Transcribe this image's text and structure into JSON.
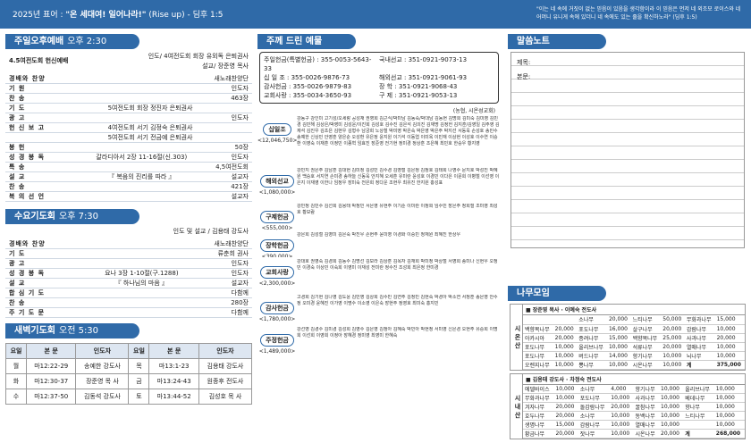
{
  "topbar": {
    "year_theme_prefix": "2025년 표어 : ",
    "theme": "\"온 세대여! 일어나라!\"",
    "theme_rest": " (Rise up) - 딤후 1:5",
    "verse": "\"이는 네 속에 거짓이 없는 믿음이 있음을 생각함이라 이 믿음은 먼저 네 외조모 로이스와 네 어머니 유니게 속에 있더니 네 속에도 있는 줄을 확신하노라\" (딤후 1:5)"
  },
  "sunday": {
    "header": "주일오후예배",
    "time": "오후 2:30",
    "intro_left": "4.5여전도회 헌신예배",
    "intro_right1": "인도/ 4여전도회 회장 유외독 은퇴권사",
    "intro_right2": "설교/ 장준영 목사",
    "rows": [
      {
        "k": "경배와 찬양",
        "m": "",
        "r": "새노래찬양단"
      },
      {
        "k": "기 원",
        "m": "",
        "r": "인도자"
      },
      {
        "k": "찬 송",
        "m": "",
        "r": "463장"
      },
      {
        "k": "기 도",
        "m": "5여전도회 회장 정진자 은퇴권사",
        "r": ""
      },
      {
        "k": "광 고",
        "m": "",
        "r": "인도자"
      },
      {
        "k": "헌 신 보 고",
        "m": "4여전도회 서기 김정숙 은퇴권사",
        "r": ""
      },
      {
        "k": "",
        "m": "5여전도회 서기 전금예 은퇴권사",
        "r": ""
      },
      {
        "k": "봉 헌",
        "m": "",
        "r": "50장"
      },
      {
        "k": "성 경 봉 독",
        "m": "갈라디아서 2장 11-16절(신.303)",
        "r": "인도자"
      },
      {
        "k": "특 송",
        "m": "",
        "r": "4,5여전도회"
      },
      {
        "k": "설 교",
        "m": "『 복음의 진리를 따라 』",
        "r": "설교자"
      },
      {
        "k": "찬 송",
        "m": "",
        "r": "421장"
      },
      {
        "k": "복 의 선 언",
        "m": "",
        "r": "설교자"
      }
    ]
  },
  "wednesday": {
    "header": "수요기도회",
    "time": "오후 7:30",
    "intro_right": "인도 및 설교 / 김용태 강도사",
    "rows": [
      {
        "k": "경배와 찬양",
        "m": "",
        "r": "새노래찬양단"
      },
      {
        "k": "기 도",
        "m": "",
        "r": "류춘희 권사"
      },
      {
        "k": "광 고",
        "m": "",
        "r": "인도자"
      },
      {
        "k": "성 경 봉 독",
        "m": "요나 3장 1-10절(구.1288)",
        "r": "인도자"
      },
      {
        "k": "설 교",
        "m": "『 하나님의 마음 』",
        "r": "설교자"
      },
      {
        "k": "합 심 기 도",
        "m": "",
        "r": "다함께"
      },
      {
        "k": "찬 송",
        "m": "",
        "r": "280장"
      },
      {
        "k": "주 기 도 문",
        "m": "",
        "r": "다함께"
      }
    ]
  },
  "dawn": {
    "header": "새벽기도회",
    "time": "오전 5:30",
    "cols": [
      "요일",
      "본 문",
      "인도자",
      "요일",
      "본 문",
      "인도자"
    ],
    "rows": [
      [
        "월",
        "마12:22-29",
        "송예한 강도사",
        "목",
        "마13:1-23",
        "김용태 강도사"
      ],
      [
        "화",
        "마12:30-37",
        "장준영 목 사",
        "금",
        "마13:24-43",
        "원종후 전도사"
      ],
      [
        "수",
        "마12:37-50",
        "김동석 강도사",
        "토",
        "마13:44-52",
        "김성호 목 사"
      ]
    ]
  },
  "offering": {
    "header": "주께 드린 예물",
    "accounts": [
      "주일헌금(특별헌금) : 355-0053-5643-33",
      "국내선교 : 351-0921-9073-13",
      "십 일 조 : 355-0026-9876-73",
      "해외선교 : 351-0921-9061-93",
      "감사헌금 : 355-0026-9879-83",
      "장 학 : 351-0921-9068-43",
      "교회사랑 : 355-0034-3650-93",
      "구 제 : 351-0921-9053-13"
    ],
    "bank": "(농협, 시온성교회)",
    "items": [
      {
        "label": "십일조",
        "amount": "<12,046,750>",
        "names": "강동구 강인미 고기성/오세랑 공성재 권영희 김근식/박미남 김동숙/박대남 김동현 김명희 김미숙 김미영 김민경 김민해 김상은/박영미 김성운/이진희 김성호 김수진 김은석 김의진 김재명 김정헌 김지훈/김영일 김주영 김재석 김진우 김초은 김현우 김형수 남궁희 노상철 박미영 박은숙 박은영 박은주 박지선 서동욱 손성호 송민수 송예한 신상민 안영훈 양은순 오성환 유은정 윤지원 이기석 이동엽 이미옥 이민재 이상현 이성호 이수연 이승환 이영숙 이재훈 이정민 이종혁 임효진 장준영 전기현 정미경 정상훈 조은혜 최민호 한승우 황지영"
      },
      {
        "label": "해외선교",
        "amount": "<1,080,000>",
        "names": "강민지 권은주 김남훈 김대현 김미정 김성민 김수경 김영철 김은정 김정호 김태희 나영수 문지호 박성진 박혜원 백승호 서지연 손미경 송하늘 신동욱 안지혜 오세훈 유미란 윤성호 이경민 이다은 이문희 이병철 이선영 이은지 이재영 이한나 임정우 장미숙 전은희 정다운 조현우 최유진 한지원 홍성표"
      },
      {
        "label": "구제헌금",
        "amount": "<555,000>",
        "names": "강민정 김민수 김선희 김용태 박정민 서은영 유현주 이기순 이미란 이정희 임수빈 장은주 정희철 조미영 최성호 황보람"
      },
      {
        "label": "장학헌금",
        "amount": "<390,000>",
        "names": "강은희 김성철 김영미 김은숙 박진우 손현주 윤미영 이경화 이승민 정재원 최혜진 한상우"
      },
      {
        "label": "교회사랑",
        "amount": "<2,300,000>",
        "names": "강대호 권영숙 김경희 김동수 김명선 김보라 김상훈 김옥자 김재희 박미정 박상철 서영희 송미나 신현우 오정민 이경숙 이상민 이숙희 이영미 이재성 전미란 정수진 조성희 최은정 한미경"
      },
      {
        "label": "감사헌금",
        "amount": "<1,780,000>",
        "names": "고경희 김기현 김나영 김도윤 김민영 김상희 김수민 김연주 김정민 김현숙 박경아 박소연 서정훈 송은영 안수정 오미경 윤혜진 이가영 이명수 이소영 이은숙 장현주 정영호 최미숙 홍지민"
      },
      {
        "label": "주정헌금",
        "amount": "<1,489,000>",
        "names": "강선영 김경수 김미경 김성희 김영수 김은영 김정아 김혜숙 박민아 박현정 서미영 신은경 오현주 유승희 이명희 이선희 이영희 이정아 장혜경 정미영 최영미 한혜숙"
      }
    ]
  },
  "memo": {
    "header": "말씀노트",
    "title_label": "제목:",
    "body_label": "본문:"
  },
  "sharing": {
    "header": "나무모임",
    "groups": [
      {
        "side": "시 온 산",
        "title": "■ 장준영 목사 · 이예숙 전도사",
        "rows": [
          [
            "",
            "",
            "소나무",
            "20,000",
            "느티나무",
            "50,000",
            "무화과나무",
            "15,000"
          ],
          [
            "백향목나무",
            "20,000",
            "포도나무",
            "16,000",
            "살구나무",
            "20,000",
            "감람나무",
            "10,000"
          ],
          [
            "아카시아",
            "20,000",
            "종려나무",
            "15,000",
            "백향목나무",
            "25,000",
            "사과나무",
            "20,000"
          ],
          [
            "포도나무",
            "10,000",
            "올리브나무",
            "10,000",
            "석류나무",
            "20,000",
            "열매나무",
            "10,000"
          ],
          [
            "포도나무",
            "10,000",
            "버드나무",
            "14,000",
            "향기나무",
            "10,000",
            "뇌나무",
            "10,000"
          ],
          [
            "오렌지나무",
            "10,000",
            "뽕나무",
            "10,000",
            "시온나무",
            "10,000",
            "계",
            "375,000"
          ]
        ]
      },
      {
        "side": "시 내 산",
        "title": "■ 김용태 강도사 · 차정숙 전도사",
        "rows": [
          [
            "에델바이스",
            "10,000",
            "소나무",
            "4,000",
            "향기나무",
            "10,000",
            "올리브나무",
            "10,000"
          ],
          [
            "무화과나무",
            "10,000",
            "포도나무",
            "10,000",
            "사과나무",
            "10,000",
            "베데나무",
            "10,000"
          ],
          [
            "겨자나무",
            "20,000",
            "돌감람나무",
            "20,000",
            "꿀참나무",
            "10,000",
            "향나무",
            "10,000"
          ],
          [
            "호두나무",
            "20,000",
            "소나무",
            "10,000",
            "동백나무",
            "10,000",
            "느티나무",
            "10,000"
          ],
          [
            "생명나무",
            "15,000",
            "감람나무",
            "10,000",
            "열매나무",
            "10,000",
            "",
            "10,000"
          ],
          [
            "황금나무",
            "20,000",
            "잣나무",
            "10,000",
            "시온나무",
            "20,000",
            "계",
            "268,000"
          ]
        ]
      }
    ]
  }
}
